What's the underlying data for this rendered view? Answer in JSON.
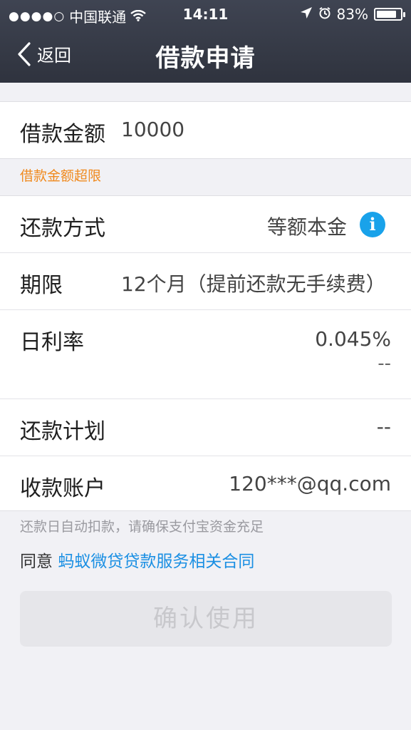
{
  "status_bar": {
    "signal": "●●●●○",
    "carrier": "中国联通",
    "time": "14:11",
    "battery_percent": "83%",
    "battery_level": 0.83,
    "wifi_icon": "wifi-icon",
    "location_icon": "location-arrow-icon",
    "alarm_icon": "alarm-clock-icon"
  },
  "nav": {
    "back_label": "返回",
    "title": "借款申请"
  },
  "form": {
    "amount_label": "借款金额",
    "amount_value": "10000",
    "amount_error": "借款金额超限",
    "repay_method_label": "还款方式",
    "repay_method_value": "等额本金",
    "term_label": "期限",
    "term_value": "12个月（提前还款无手续费）",
    "daily_rate_label": "日利率",
    "daily_rate_value": "0.045%",
    "daily_rate_secondary": "--",
    "repay_plan_label": "还款计划",
    "repay_plan_value": "--",
    "receive_account_label": "收款账户",
    "receive_account_value": "120***@qq.com"
  },
  "footer": {
    "note": "还款日自动扣款，请确保支付宝资金充足",
    "agree_prefix": "同意 ",
    "agree_link": "蚂蚁微贷贷款服务相关合同",
    "confirm_button": "确认使用"
  },
  "colors": {
    "nav_bg": "#353a46",
    "accent_blue": "#19a2ea",
    "link_blue": "#1a8fe3",
    "warning_orange": "#f08a1f",
    "disabled_button_bg": "#e6e6ea"
  }
}
